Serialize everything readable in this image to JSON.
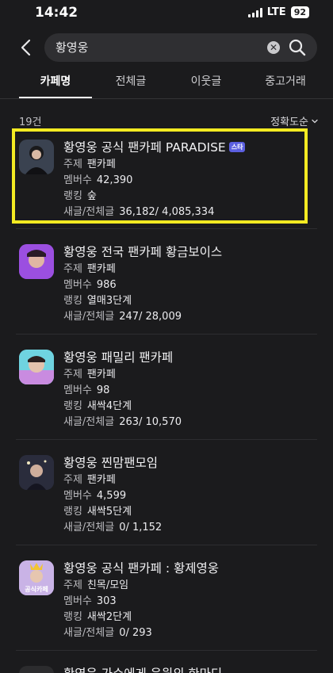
{
  "status": {
    "time": "14:42",
    "network": "LTE",
    "battery": "92"
  },
  "search": {
    "query": "황영웅"
  },
  "tabs": [
    {
      "label": "카페명"
    },
    {
      "label": "전체글"
    },
    {
      "label": "이웃글"
    },
    {
      "label": "중고거래"
    }
  ],
  "results": {
    "count_label": "19건",
    "sort_label": "정확도순"
  },
  "cafes": [
    {
      "name": "황영웅 공식 팬카페 PARADISE",
      "badge": "스타",
      "topic_label": "주제",
      "topic": "팬카페",
      "members_label": "멤버수",
      "members": "42,390",
      "rank_label": "랭킹",
      "rank": "숲",
      "posts_label": "새글/전체글",
      "posts": "36,182/ 4,085,334",
      "avatar_color": "#3a4250"
    },
    {
      "name": "황영웅 전국 팬카페 황금보이스",
      "topic_label": "주제",
      "topic": "팬카페",
      "members_label": "멤버수",
      "members": "986",
      "rank_label": "랭킹",
      "rank": "열매3단계",
      "posts_label": "새글/전체글",
      "posts": "247/ 28,009",
      "avatar_color": "#7a3fc8"
    },
    {
      "name": "황영웅 패밀리 팬카페",
      "topic_label": "주제",
      "topic": "팬카페",
      "members_label": "멤버수",
      "members": "98",
      "rank_label": "랭킹",
      "rank": "새싹4단계",
      "posts_label": "새글/전체글",
      "posts": "263/ 10,570",
      "avatar_color": "#59c7d8"
    },
    {
      "name": "황영웅 찐맘팬모임",
      "topic_label": "주제",
      "topic": "팬카페",
      "members_label": "멤버수",
      "members": "4,599",
      "rank_label": "랭킹",
      "rank": "새싹5단계",
      "posts_label": "새글/전체글",
      "posts": "0/ 1,152",
      "avatar_color": "#2a2c3c"
    },
    {
      "name": "황영웅 공식 팬카페 : 황제영웅",
      "topic_label": "주제",
      "topic": "친목/모임",
      "members_label": "멤버수",
      "members": "303",
      "rank_label": "랭킹",
      "rank": "새싹2단계",
      "posts_label": "새글/전체글",
      "posts": "0/ 293",
      "avatar_color": "#b39ad8",
      "avatar_caption": "공식카페"
    },
    {
      "name": "황영웅 가수에게 응원의 한마디",
      "avatar_color": "#2c2c2e"
    }
  ]
}
